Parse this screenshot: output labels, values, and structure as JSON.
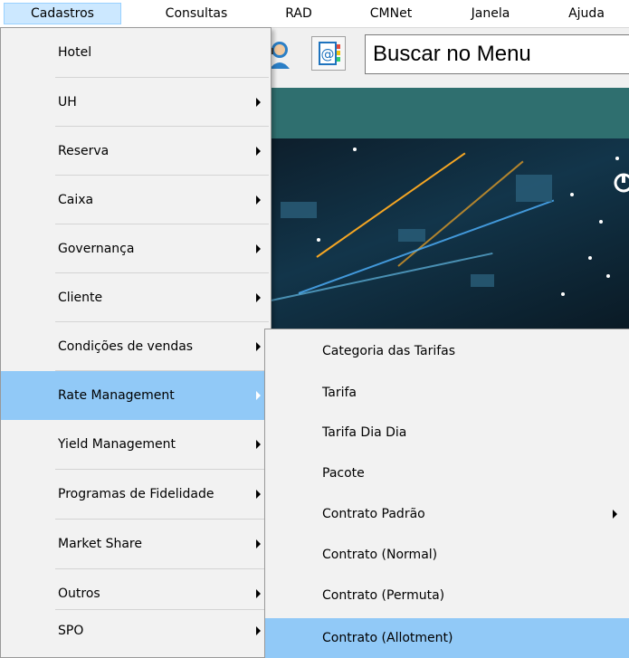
{
  "menubar": {
    "items": [
      {
        "label": "Cadastros"
      },
      {
        "label": "Consultas"
      },
      {
        "label": "RAD"
      },
      {
        "label": "CMNet"
      },
      {
        "label": "Janela"
      },
      {
        "label": "Ajuda"
      }
    ]
  },
  "search": {
    "text": "Buscar no Menu"
  },
  "cadastros_menu": {
    "items": [
      {
        "label": "Hotel",
        "submenu": false
      },
      {
        "label": "UH",
        "submenu": true
      },
      {
        "label": "Reserva",
        "submenu": true
      },
      {
        "label": "Caixa",
        "submenu": true
      },
      {
        "label": "Governança",
        "submenu": true
      },
      {
        "label": "Cliente",
        "submenu": true
      },
      {
        "label": "Condições de vendas",
        "submenu": true
      },
      {
        "label": "Rate Management",
        "submenu": true,
        "highlighted": true
      },
      {
        "label": "Yield Management",
        "submenu": true
      },
      {
        "label": "Programas de Fidelidade",
        "submenu": true
      },
      {
        "label": "Market Share",
        "submenu": true
      },
      {
        "label": "Outros",
        "submenu": true
      },
      {
        "label": "SPO",
        "submenu": true
      }
    ]
  },
  "rate_management_menu": {
    "items": [
      {
        "label": "Categoria das Tarifas",
        "submenu": false
      },
      {
        "label": "Tarifa",
        "submenu": false
      },
      {
        "label": "Tarifa Dia Dia",
        "submenu": false
      },
      {
        "label": "Pacote",
        "submenu": false
      },
      {
        "label": "Contrato Padrão",
        "submenu": true
      },
      {
        "label": "Contrato (Normal)",
        "submenu": false
      },
      {
        "label": "Contrato (Permuta)",
        "submenu": false
      },
      {
        "label": "Contrato (Allotment)",
        "submenu": false,
        "highlighted": true
      }
    ]
  },
  "colors": {
    "highlight": "#91c9f7",
    "menu_bg": "#f2f2f2",
    "active_menubar": "#cce8ff",
    "teal_band": "#2f6f6f"
  }
}
